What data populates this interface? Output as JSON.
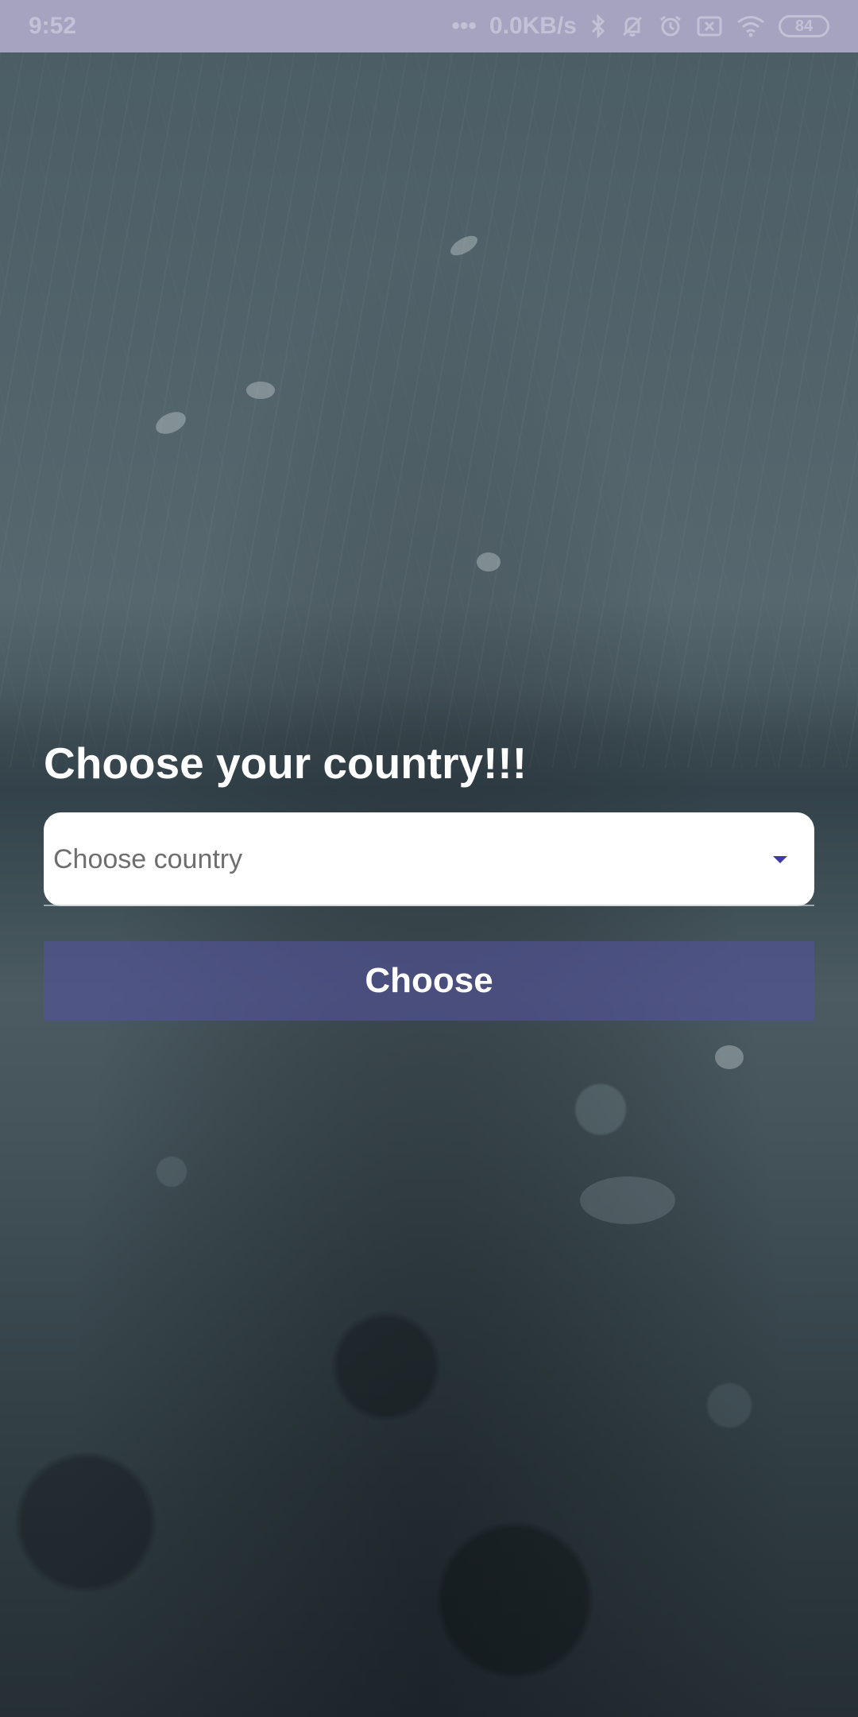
{
  "status_bar": {
    "time": "9:52",
    "dots": "•••",
    "network_speed": "0.0KB/s",
    "battery": "84",
    "icons": [
      "bluetooth-icon",
      "bell-muted-icon",
      "alarm-icon",
      "sim-off-icon",
      "wifi-icon",
      "battery-icon"
    ]
  },
  "main": {
    "title": "Choose your country!!!",
    "country_select": {
      "placeholder": "Choose country"
    },
    "choose_button_label": "Choose"
  },
  "colors": {
    "status_bar_bg": "#a5a3bf",
    "button_bg": "#52529b",
    "arrow": "#3f3aa8"
  }
}
